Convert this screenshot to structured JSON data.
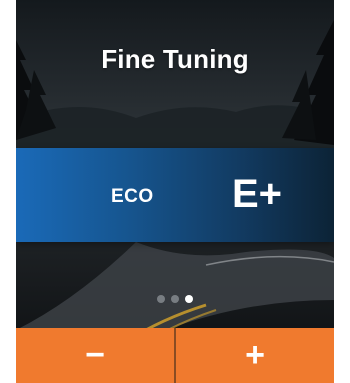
{
  "screen": {
    "title": "Fine Tuning"
  },
  "modes": {
    "previous": "ECO",
    "current": "E+"
  },
  "pager": {
    "count": 3,
    "active_index": 2
  },
  "controls": {
    "decrease_label": "−",
    "increase_label": "+"
  },
  "colors": {
    "accent": "#f07a2e",
    "band_start": "#1a6ab8",
    "band_end": "#0c2336"
  }
}
